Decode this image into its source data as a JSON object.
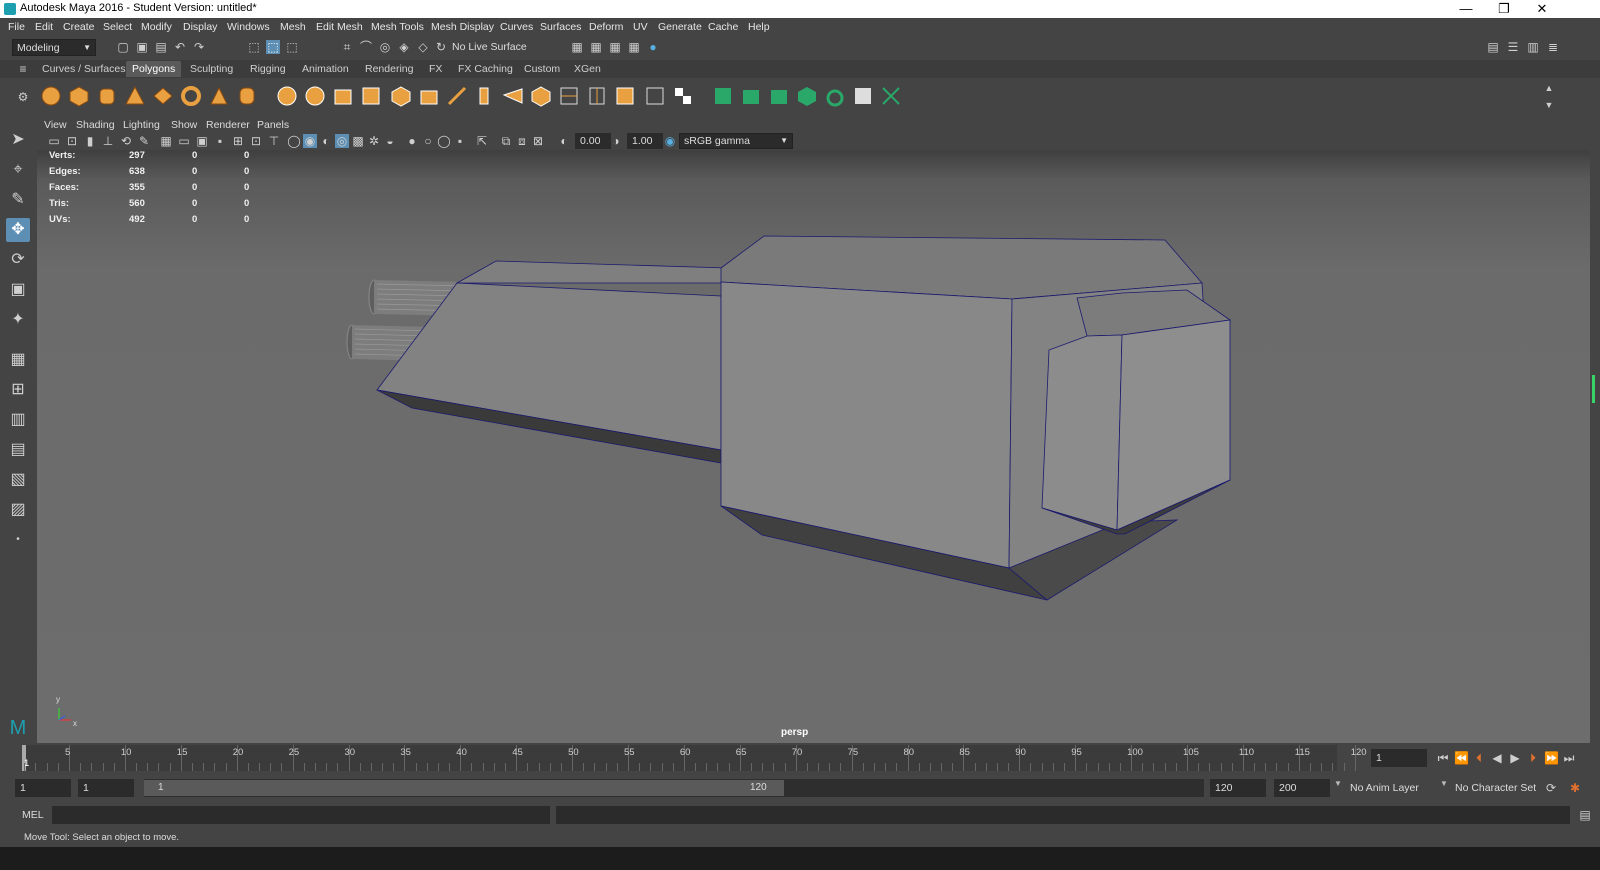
{
  "window": {
    "title": "Autodesk Maya 2016 - Student Version: untitled*",
    "minimize_glyph": "—",
    "restore_glyph": "❐",
    "close_glyph": "✕"
  },
  "menubar": [
    "File",
    "Edit",
    "Create",
    "Select",
    "Modify",
    "Display",
    "Windows",
    "Mesh",
    "Edit Mesh",
    "Mesh Tools",
    "Mesh Display",
    "Curves",
    "Surfaces",
    "Deform",
    "UV",
    "Generate",
    "Cache",
    "Help"
  ],
  "statusline": {
    "mode": "Modeling",
    "live_surface": "No Live Surface"
  },
  "shelf_tabs": [
    "Curves / Surfaces",
    "Polygons",
    "Sculpting",
    "Rigging",
    "Animation",
    "Rendering",
    "FX",
    "FX Caching",
    "Custom",
    "XGen"
  ],
  "active_shelf_tab": "Polygons",
  "panel_menu": [
    "View",
    "Shading",
    "Lighting",
    "Show",
    "Renderer",
    "Panels"
  ],
  "panel_toolbar": {
    "exposure": "0.00",
    "gamma": "1.00",
    "color_space": "sRGB gamma"
  },
  "hud": {
    "rows": [
      {
        "label": "Verts:",
        "v1": "297",
        "v2": "0",
        "v3": "0"
      },
      {
        "label": "Edges:",
        "v1": "638",
        "v2": "0",
        "v3": "0"
      },
      {
        "label": "Faces:",
        "v1": "355",
        "v2": "0",
        "v3": "0"
      },
      {
        "label": "Tris:",
        "v1": "560",
        "v2": "0",
        "v3": "0"
      },
      {
        "label": "UVs:",
        "v1": "492",
        "v2": "0",
        "v3": "0"
      }
    ],
    "camera": "persp",
    "axis_y": "y",
    "axis_x": "x"
  },
  "timeline": {
    "ticks": [
      "5",
      "10",
      "15",
      "20",
      "25",
      "30",
      "35",
      "40",
      "45",
      "50",
      "55",
      "60",
      "65",
      "70",
      "75",
      "80",
      "85",
      "90",
      "95",
      "100",
      "105",
      "110",
      "115",
      "120"
    ],
    "current_frame_marker": "1",
    "current_frame": "1"
  },
  "range": {
    "start": "1",
    "playback_start": "1",
    "slider_start": "1",
    "slider_end": "120",
    "playback_end": "120",
    "end": "200",
    "anim_layer": "No Anim Layer",
    "character_set": "No Character Set"
  },
  "command": {
    "lang": "MEL"
  },
  "helpline": "Move Tool: Select an object to move.",
  "colors": {
    "viewport_bg": "#6d6d6d",
    "active_tool": "#5d8fb5",
    "wireframe": "#1a1a6e"
  }
}
